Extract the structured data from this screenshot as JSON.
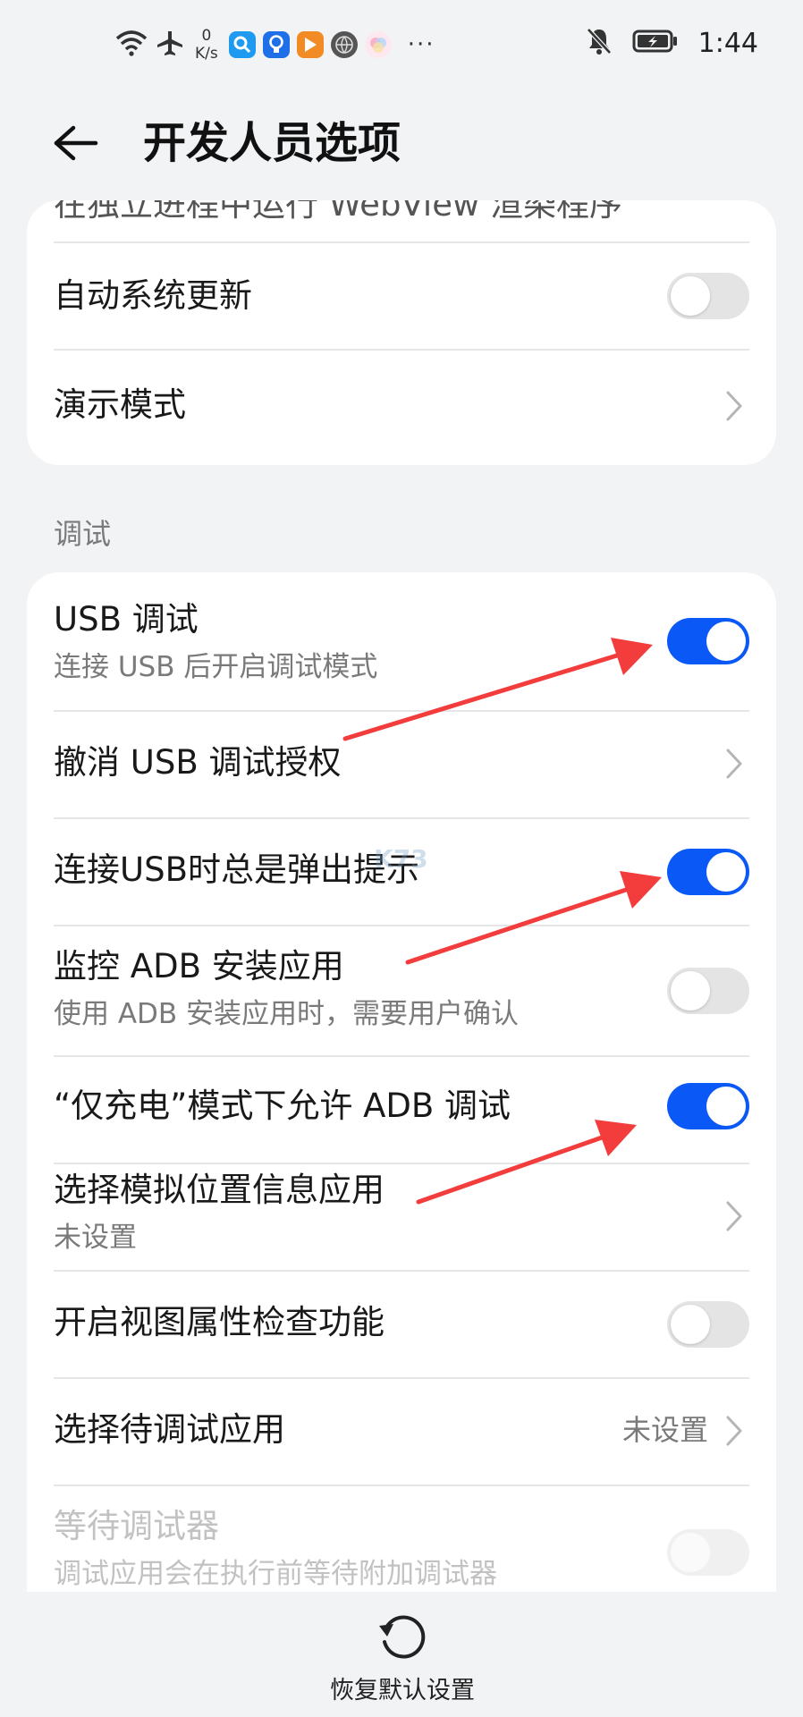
{
  "status_bar": {
    "network_speed_value": "0",
    "network_speed_unit": "K/s",
    "more_indicator": "···",
    "time": "1:44"
  },
  "header": {
    "title": "开发人员选项"
  },
  "card1": {
    "partial_row_label": "在独立进程中运行 WebView 渲染程序",
    "auto_update": {
      "label": "自动系统更新",
      "checked": false
    },
    "demo_mode": {
      "label": "演示模式"
    }
  },
  "debug_section": {
    "header": "调试",
    "usb_debugging": {
      "label": "USB 调试",
      "summary": "连接 USB 后开启调试模式",
      "checked": true
    },
    "revoke_auth": {
      "label": "撤消 USB 调试授权"
    },
    "usb_prompt": {
      "label": "连接USB时总是弹出提示",
      "checked": true
    },
    "monitor_adb": {
      "label": "监控 ADB 安装应用",
      "summary": "使用 ADB 安装应用时，需要用户确认",
      "checked": false
    },
    "charge_only_adb": {
      "label": "“仅充电”模式下允许 ADB 调试",
      "checked": true
    },
    "mock_location": {
      "label": "选择模拟位置信息应用",
      "value": "未设置"
    },
    "view_attr": {
      "label": "开启视图属性检查功能",
      "checked": false
    },
    "debug_app": {
      "label": "选择待调试应用",
      "value": "未设置"
    },
    "wait_debugger": {
      "label": "等待调试器",
      "summary": "调试应用会在执行前等待附加调试器",
      "checked": false,
      "disabled": true
    }
  },
  "bottom": {
    "restore_defaults_label": "恢复默认设置"
  },
  "watermark": {
    "text": "K73"
  },
  "colors": {
    "accent": "#0a59f7",
    "background": "#f1f3f5",
    "card": "#ffffff",
    "annotation": "#f33c3c"
  }
}
